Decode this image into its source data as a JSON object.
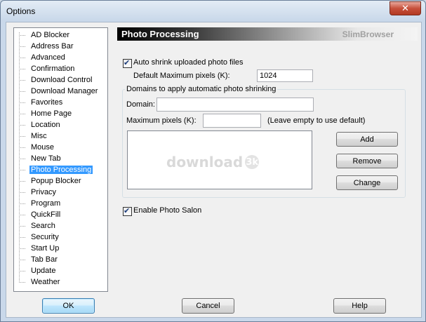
{
  "window": {
    "title": "Options",
    "close_icon": "close-icon"
  },
  "tree": {
    "items": [
      {
        "label": "AD Blocker"
      },
      {
        "label": "Address Bar"
      },
      {
        "label": "Advanced"
      },
      {
        "label": "Confirmation"
      },
      {
        "label": "Download Control"
      },
      {
        "label": "Download Manager"
      },
      {
        "label": "Favorites"
      },
      {
        "label": "Home Page"
      },
      {
        "label": "Location"
      },
      {
        "label": "Misc"
      },
      {
        "label": "Mouse"
      },
      {
        "label": "New Tab"
      },
      {
        "label": "Photo Processing",
        "selected": true
      },
      {
        "label": "Popup Blocker"
      },
      {
        "label": "Privacy"
      },
      {
        "label": "Program"
      },
      {
        "label": "QuickFill"
      },
      {
        "label": "Search"
      },
      {
        "label": "Security"
      },
      {
        "label": "Start Up"
      },
      {
        "label": "Tab Bar"
      },
      {
        "label": "Update"
      },
      {
        "label": "Weather"
      }
    ],
    "selection_color": "#3399ff"
  },
  "panel": {
    "title": "Photo Processing",
    "brand": "SlimBrowser",
    "auto_shrink": {
      "label": "Auto shrink uploaded photo files",
      "checked": true
    },
    "default_max_pixels": {
      "label": "Default Maximum pixels (K):",
      "value": "1024"
    },
    "domains_group": {
      "title": "Domains to apply automatic photo shrinking",
      "domain_label": "Domain:",
      "domain_value": "",
      "max_pixels_label": "Maximum pixels (K):",
      "max_pixels_value": "",
      "hint": "(Leave empty to use default)",
      "watermark_text": "download",
      "watermark_badge": "3k",
      "add_button": "Add",
      "remove_button": "Remove",
      "change_button": "Change"
    },
    "enable_photo_salon": {
      "label": "Enable Photo Salon",
      "checked": true
    }
  },
  "footer": {
    "ok_button": "OK",
    "cancel_button": "Cancel",
    "help_button": "Help"
  }
}
